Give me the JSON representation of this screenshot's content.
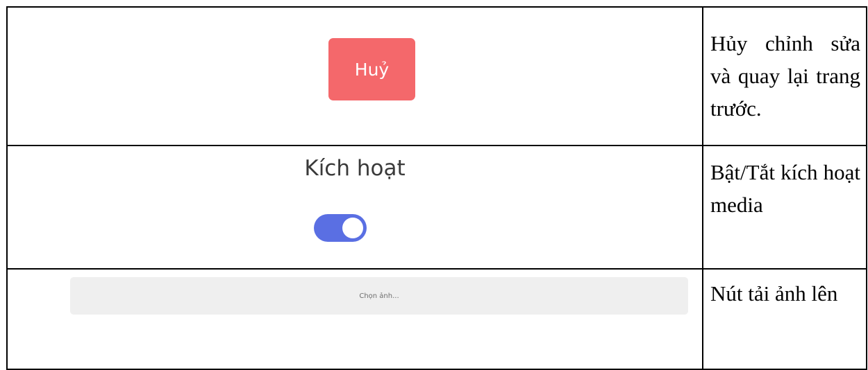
{
  "rows": [
    {
      "cancel_button_label": "Huỷ",
      "description": "Hủy chỉnh sửa và quay lại trang trước."
    },
    {
      "toggle_label": "Kích hoạt",
      "toggle_state": true,
      "toggle_color": "#5a6fe3",
      "description": "Bật/Tắt kích hoạt media"
    },
    {
      "upload_button_label": "Chọn ảnh...",
      "description": "Nút tải ảnh lên"
    }
  ],
  "colors": {
    "cancel_button": "#f4686b",
    "upload_button": "#efefef"
  }
}
